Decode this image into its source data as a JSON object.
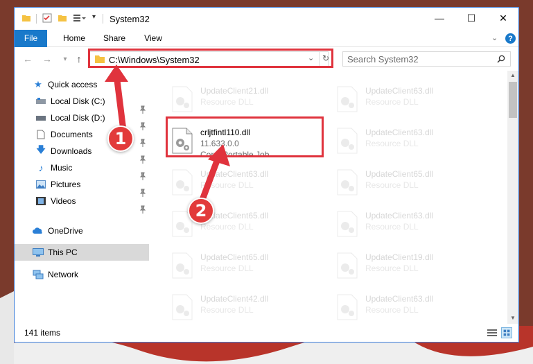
{
  "window": {
    "title": "System32",
    "controls": {
      "minimize": "—",
      "maximize": "☐",
      "close": "✕"
    }
  },
  "ribbon": {
    "tabs": [
      "File",
      "Home",
      "Share",
      "View"
    ],
    "help": "?"
  },
  "address": {
    "path": "C:\\Windows\\System32",
    "search_placeholder": "Search System32"
  },
  "sidebar": {
    "quick_access": "Quick access",
    "items": [
      "Local Disk (C:)",
      "Local Disk (D:)",
      "Documents",
      "Downloads",
      "Music",
      "Pictures",
      "Videos"
    ],
    "onedrive": "OneDrive",
    "this_pc": "This PC",
    "network": "Network"
  },
  "files": {
    "highlighted": {
      "name": "crljtfintl110.dll",
      "version": "11.633.0.0",
      "description": "Corel Portable Job ..."
    },
    "left_column": [
      {
        "name": "UpdateClient21.dll",
        "desc": "Resource DLL"
      },
      {
        "name": "UpdateClient63.dll",
        "desc": "Resource DLL"
      },
      {
        "name": "UpdateClient65.dll",
        "desc": "Resource DLL"
      },
      {
        "name": "UpdateClient65.dll",
        "desc": "Resource DLL"
      },
      {
        "name": "UpdateClient42.dll",
        "desc": "Resource DLL"
      }
    ],
    "right_column": [
      {
        "name": "UpdateClient63.dll",
        "desc": "Resource DLL"
      },
      {
        "name": "UpdateClient63.dll",
        "desc": "Resource DLL"
      },
      {
        "name": "UpdateClient65.dll",
        "desc": "Resource DLL"
      },
      {
        "name": "UpdateClient63.dll",
        "desc": "Resource DLL"
      },
      {
        "name": "UpdateClient19.dll",
        "desc": "Resource DLL"
      },
      {
        "name": "UpdateClient63.dll",
        "desc": "Resource DLL"
      }
    ]
  },
  "status": {
    "items": "141 items"
  },
  "annotations": {
    "step1": "1",
    "step2": "2"
  },
  "colors": {
    "accent": "#1979ca",
    "annotation": "#e0333d",
    "selection": "#d9d9d9"
  }
}
